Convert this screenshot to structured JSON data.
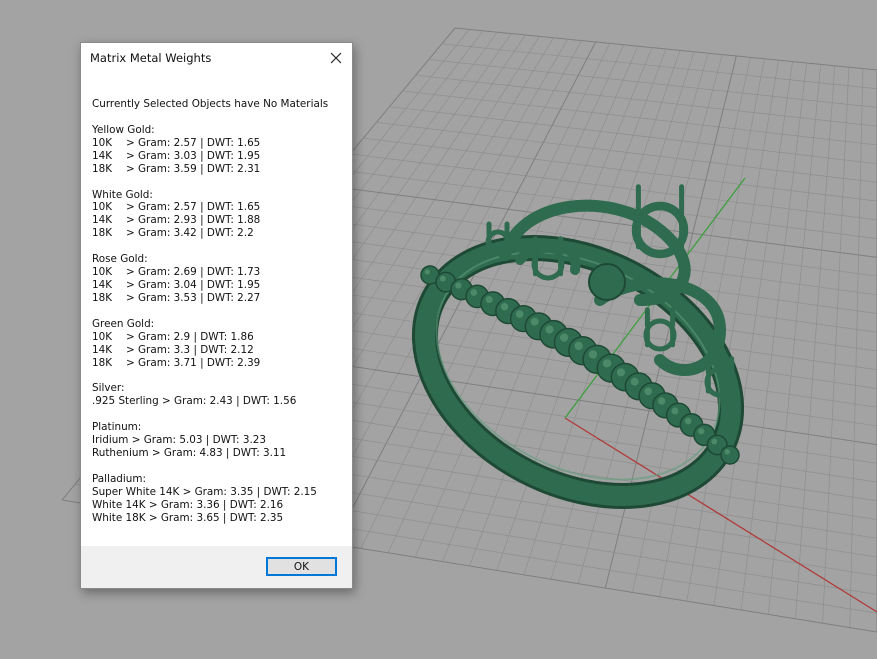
{
  "dialog": {
    "title": "Matrix Metal Weights",
    "heading": "Currently Selected Objects have No Materials",
    "ok_label": "OK",
    "sections": [
      {
        "title": "Yellow Gold:",
        "rows": [
          {
            "key": "10K",
            "value": "> Gram: 2.57 | DWT: 1.65"
          },
          {
            "key": "14K",
            "value": "> Gram: 3.03 | DWT: 1.95"
          },
          {
            "key": "18K",
            "value": "> Gram: 3.59 | DWT: 2.31"
          }
        ]
      },
      {
        "title": "White Gold:",
        "rows": [
          {
            "key": "10K",
            "value": "> Gram: 2.57 | DWT: 1.65"
          },
          {
            "key": "14K",
            "value": "> Gram: 2.93 | DWT: 1.88"
          },
          {
            "key": "18K",
            "value": "> Gram: 3.42 | DWT: 2.2"
          }
        ]
      },
      {
        "title": "Rose Gold:",
        "rows": [
          {
            "key": "10K",
            "value": "> Gram: 2.69 | DWT: 1.73"
          },
          {
            "key": "14K",
            "value": "> Gram: 3.04 | DWT: 1.95"
          },
          {
            "key": "18K",
            "value": "> Gram: 3.53 | DWT: 2.27"
          }
        ]
      },
      {
        "title": "Green Gold:",
        "rows": [
          {
            "key": "10K",
            "value": "> Gram: 2.9 | DWT: 1.86"
          },
          {
            "key": "14K",
            "value": "> Gram: 3.3 | DWT: 2.12"
          },
          {
            "key": "18K",
            "value": "> Gram: 3.71 | DWT: 2.39"
          }
        ]
      },
      {
        "title": "Silver:",
        "rows": [
          {
            "text": ".925 Sterling > Gram: 2.43 | DWT: 1.56"
          }
        ]
      },
      {
        "title": "Platinum:",
        "rows": [
          {
            "text": "Iridium > Gram: 5.03 | DWT: 3.23"
          },
          {
            "text": "Ruthenium > Gram: 4.83 | DWT: 3.11"
          }
        ]
      },
      {
        "title": "Palladium:",
        "rows": [
          {
            "text": "Super White 14K > Gram: 3.35 | DWT: 2.15"
          },
          {
            "text": "White 14K > Gram: 3.36 | DWT: 2.16"
          },
          {
            "text": "White 18K > Gram: 3.65 | DWT: 2.35"
          }
        ]
      }
    ]
  },
  "viewport": {
    "background_color": "#a3a3a3",
    "grid_color": "#8e8e8e",
    "grid_major_color": "#7f7f7f",
    "x_axis_color": "#b03a3a",
    "y_axis_color": "#3ea03e",
    "ring_color": "#2f6b4e",
    "ring_shadow_color": "#1e4a35",
    "ring_highlight_color": "#5f9c7c",
    "icons": [
      "close-icon",
      "ring-model"
    ]
  }
}
